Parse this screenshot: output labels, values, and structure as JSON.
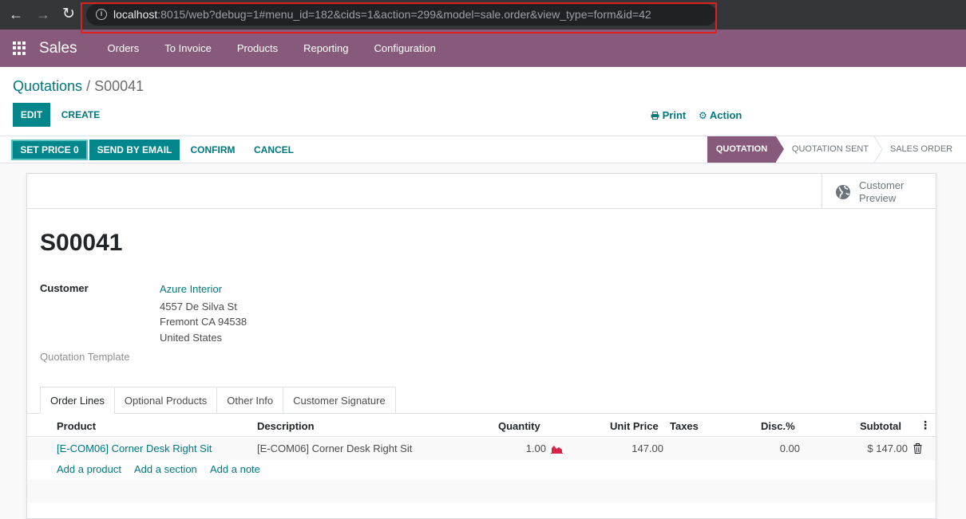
{
  "browser": {
    "url_host": "localhost",
    "url_rest": ":8015/web?debug=1#menu_id=182&cids=1&action=299&model=sale.order&view_type=form&id=42"
  },
  "app_nav": {
    "title": "Sales",
    "menu": [
      "Orders",
      "To Invoice",
      "Products",
      "Reporting",
      "Configuration"
    ]
  },
  "breadcrumb": {
    "parent": "Quotations",
    "separator": "/",
    "current": "S00041"
  },
  "control_panel": {
    "edit_label": "EDIT",
    "create_label": "CREATE",
    "print_label": "Print",
    "action_label": "Action"
  },
  "status_bar": {
    "buttons": [
      "SET PRICE 0",
      "SEND BY EMAIL",
      "CONFIRM",
      "CANCEL"
    ],
    "stages": [
      "QUOTATION",
      "QUOTATION SENT",
      "SALES ORDER"
    ],
    "active_stage": "QUOTATION"
  },
  "stat_button": {
    "line1": "Customer",
    "line2": "Preview"
  },
  "order": {
    "name": "S00041",
    "customer_label": "Customer",
    "customer_name": "Azure Interior",
    "address_line1": "4557 De Silva St",
    "address_line2": "Fremont CA 94538",
    "address_line3": "United States",
    "template_label": "Quotation Template"
  },
  "tabs": [
    "Order Lines",
    "Optional Products",
    "Other Info",
    "Customer Signature"
  ],
  "lines": {
    "headers": {
      "product": "Product",
      "description": "Description",
      "quantity": "Quantity",
      "unit_price": "Unit Price",
      "taxes": "Taxes",
      "discount": "Disc.%",
      "subtotal": "Subtotal"
    },
    "rows": [
      {
        "product": "[E-COM06] Corner Desk Right Sit",
        "description": "[E-COM06] Corner Desk Right Sit",
        "quantity": "1.00",
        "unit_price": "147.00",
        "taxes": "",
        "discount": "0.00",
        "subtotal": "$ 147.00"
      }
    ],
    "add_product": "Add a product",
    "add_section": "Add a section",
    "add_note": "Add a note"
  },
  "colors": {
    "brand": "#875a7b",
    "accent": "#00868b",
    "link": "#00787f",
    "url_highlight": "#e0201c"
  },
  "icons": [
    "back-arrow-icon",
    "forward-arrow-icon",
    "reload-icon",
    "info-icon",
    "apps-grid-icon",
    "print-icon",
    "gear-icon",
    "globe-icon",
    "forecast-chart-icon",
    "trash-icon",
    "kebab-menu-icon"
  ]
}
